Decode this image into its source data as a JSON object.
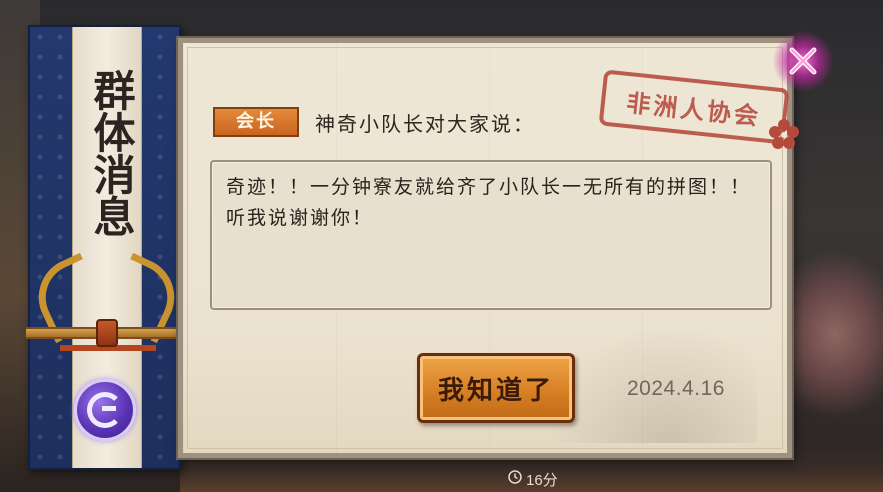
{
  "banner": {
    "title": "群体消息",
    "seal_icon": "guild-emblem-icon"
  },
  "message": {
    "role_badge": "会长",
    "speaker_line": "神奇小队长对大家说：",
    "body": "奇迹！！一分钟寮友就给齐了小队长一无所有的拼图！！听我说谢谢你！",
    "stamp_text": "非洲人协会",
    "date": "2024.4.16"
  },
  "actions": {
    "ack_label": "我知道了",
    "close_icon": "close-x-icon"
  },
  "background": {
    "timer_text": "16分"
  },
  "colors": {
    "banner_blue": "#23386e",
    "parchment": "#efe7d6",
    "button_orange": "#e08a30",
    "badge_orange": "#d8742a",
    "stamp_red": "#b54a3c",
    "seal_purple": "#5b35b5"
  }
}
